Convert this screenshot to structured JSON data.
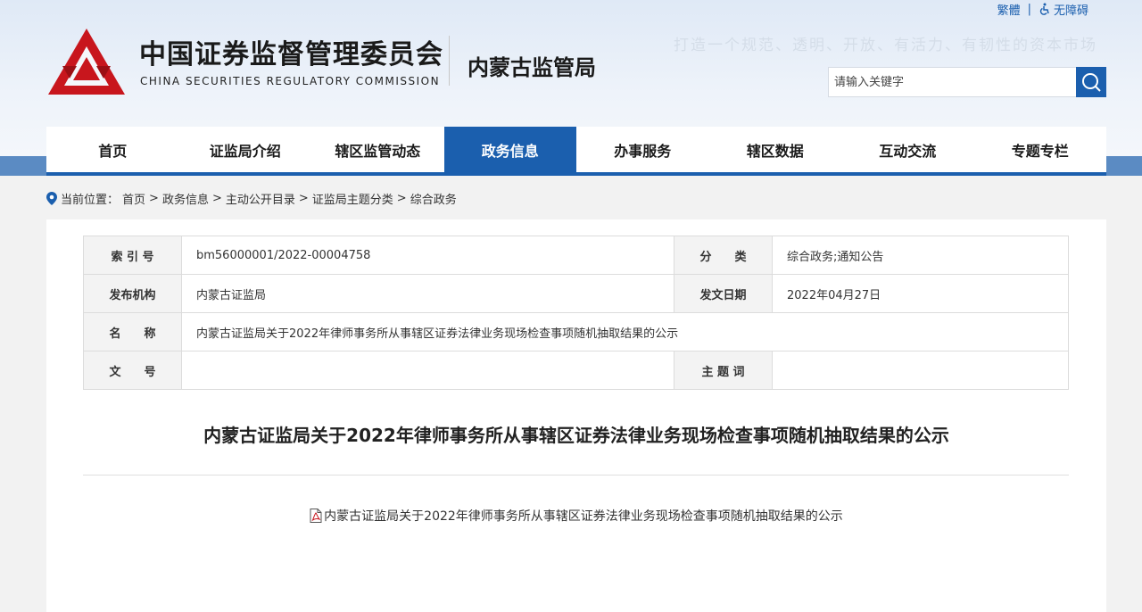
{
  "top_links": {
    "traditional": "繁體",
    "separator": "|",
    "accessibility": "无障碍"
  },
  "brand": {
    "name_cn": "中国证券监督管理委员会",
    "name_en": "CHINA SECURITIES REGULATORY COMMISSION",
    "sub_org": "内蒙古监管局",
    "slogan": "打造一个规范、透明、开放、有活力、有韧性的资本市场"
  },
  "search": {
    "placeholder": "请输入关键字"
  },
  "nav": {
    "items": [
      {
        "label": "首页"
      },
      {
        "label": "证监局介绍"
      },
      {
        "label": "辖区监管动态"
      },
      {
        "label": "政务信息"
      },
      {
        "label": "办事服务"
      },
      {
        "label": "辖区数据"
      },
      {
        "label": "互动交流"
      },
      {
        "label": "专题专栏"
      }
    ],
    "active_index": 3
  },
  "breadcrumb": {
    "prefix": "当前位置：",
    "items": [
      "首页",
      "政务信息",
      "主动公开目录",
      "证监局主题分类",
      "综合政务"
    ],
    "separator": ">"
  },
  "meta": {
    "index_label": "索 引 号",
    "index_value": "bm56000001/2022-00004758",
    "category_label": "分　　类",
    "category_value": "综合政务;通知公告",
    "issuer_label": "发布机构",
    "issuer_value": "内蒙古证监局",
    "date_label": "发文日期",
    "date_value": "2022年04月27日",
    "name_label": "名　　称",
    "name_value": "内蒙古证监局关于2022年律师事务所从事辖区证券法律业务现场检查事项随机抽取结果的公示",
    "docno_label": "文　　号",
    "docno_value": "",
    "keywords_label": "主 题 词",
    "keywords_value": ""
  },
  "document": {
    "title": "内蒙古证监局关于2022年律师事务所从事辖区证券法律业务现场检查事项随机抽取结果的公示",
    "attachment": "内蒙古证监局关于2022年律师事务所从事辖区证券法律业务现场检查事项随机抽取结果的公示"
  },
  "colors": {
    "primary": "#1b5fae",
    "band": "#5b8bc3",
    "logo_red": "#c8161d"
  }
}
